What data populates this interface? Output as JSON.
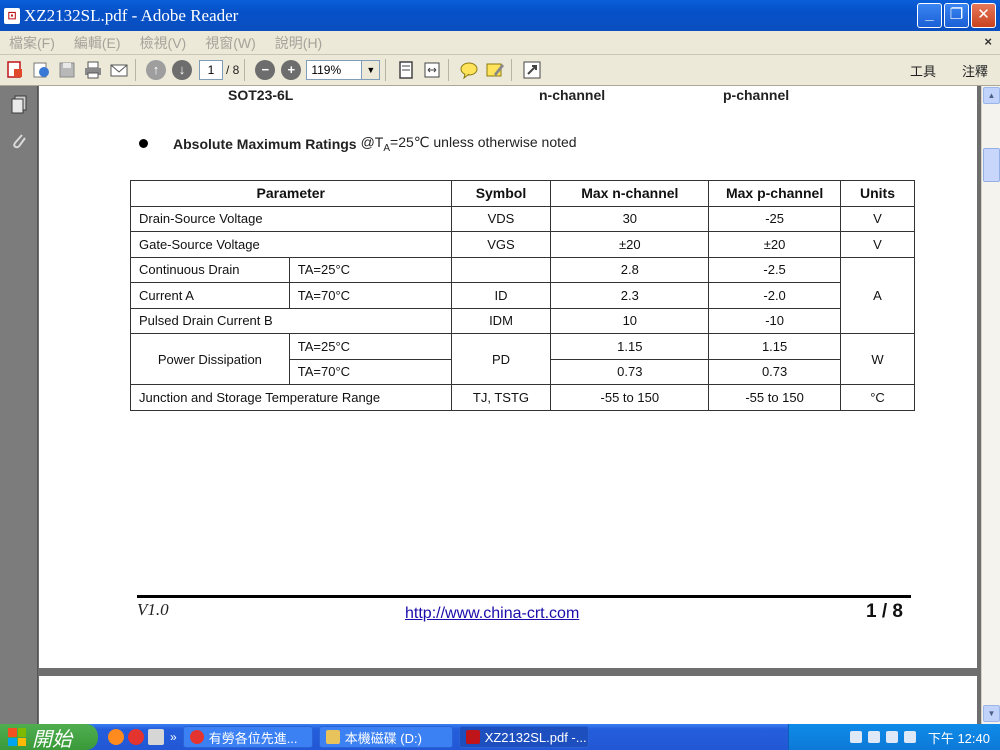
{
  "window": {
    "title": "XZ2132SL.pdf - Adobe Reader",
    "app_icon": "pdf-icon",
    "minimize": "_",
    "maximize": "❐",
    "close": "✕"
  },
  "menu": {
    "items": [
      "檔案(F)",
      "編輯(E)",
      "檢視(V)",
      "視窗(W)",
      "說明(H)"
    ],
    "close": "×"
  },
  "toolbar": {
    "page_current": "1",
    "page_total": "/ 8",
    "zoom": "119%",
    "zoom_arrow": "▼",
    "tools_label": "工具",
    "comment_label": "注釋"
  },
  "document": {
    "package_label": "SOT23-6L",
    "nchannel_label": "n-channel",
    "pchannel_label": "p-channel",
    "section_title": "Absolute Maximum Ratings",
    "section_cond_prefix": "@T",
    "section_cond_sub": "A",
    "section_cond_suffix": "=25℃  unless otherwise noted",
    "table": {
      "headers": [
        "Parameter",
        "Symbol",
        "Max n-channel",
        "Max p-channel",
        "Units"
      ],
      "rows": [
        {
          "param": "Drain-Source Voltage",
          "symbol": "VDS",
          "n": "30",
          "p": "-25",
          "unit": "V"
        },
        {
          "param": "Gate-Source Voltage",
          "symbol": "VGS",
          "n": "±20",
          "p": "±20",
          "unit": "V"
        },
        {
          "param": "Continuous Drain",
          "cond": "TA=25°C",
          "symbol": "",
          "n": "2.8",
          "p": "-2.5",
          "unit": "A"
        },
        {
          "param": "Current A",
          "cond": "TA=70°C",
          "symbol": "ID",
          "n": "2.3",
          "p": "-2.0"
        },
        {
          "param": "Pulsed Drain Current B",
          "symbol": "IDM",
          "n": "10",
          "p": "-10"
        },
        {
          "param": "Power Dissipation",
          "cond": "TA=25°C",
          "symbol": "PD",
          "n": "1.15",
          "p": "1.15",
          "unit": "W"
        },
        {
          "cond": "TA=70°C",
          "n": "0.73",
          "p": "0.73"
        },
        {
          "param": "Junction and Storage Temperature Range",
          "symbol": "TJ, TSTG",
          "n": "-55 to 150",
          "p": "-55 to 150",
          "unit": "°C"
        }
      ]
    },
    "footer": {
      "version": "V1.0",
      "url": "http://www.china-crt.com",
      "page": "1 / 8"
    }
  },
  "taskbar": {
    "start_label": "開始",
    "quick_more": "»",
    "tasks": [
      {
        "label": "有勞各位先進...",
        "active": false
      },
      {
        "label": "本機磁碟 (D:)",
        "active": false
      },
      {
        "label": "XZ2132SL.pdf -...",
        "active": true
      }
    ],
    "clock": "下午 12:40"
  },
  "colors": {
    "titlebar": "#0650c8",
    "chrome": "#ece9d8",
    "link": "#1a0dab",
    "taskbar": "#245edc",
    "start": "#3a9a3a"
  }
}
